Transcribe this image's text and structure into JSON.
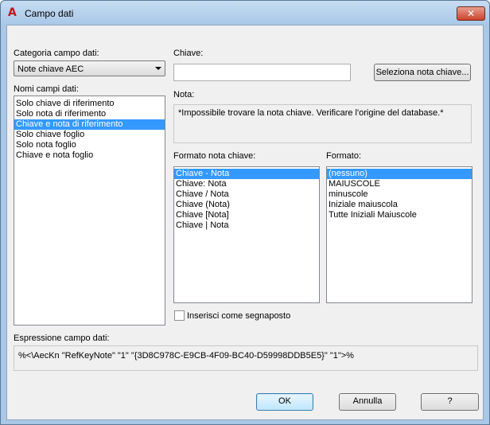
{
  "window": {
    "title": "Campo dati",
    "close_glyph": "✕",
    "app_icon": "A"
  },
  "category": {
    "label": "Categoria campo dati:",
    "selected": "Note chiave AEC"
  },
  "field_names": {
    "label": "Nomi campi dati:",
    "items": [
      {
        "label": "Solo chiave di riferimento",
        "selected": false
      },
      {
        "label": "Solo nota di riferimento",
        "selected": false
      },
      {
        "label": "Chiave e nota di riferimento",
        "selected": true
      },
      {
        "label": "Solo chiave foglio",
        "selected": false
      },
      {
        "label": "Solo nota foglio",
        "selected": false
      },
      {
        "label": "Chiave e nota foglio",
        "selected": false
      }
    ]
  },
  "key": {
    "label": "Chiave:",
    "value": "",
    "select_button": "Seleziona nota chiave..."
  },
  "note": {
    "label": "Nota:",
    "text": "*Impossibile trovare la nota chiave. Verificare l'origine del database.*"
  },
  "key_note_format": {
    "label": "Formato nota chiave:",
    "items": [
      {
        "label": "Chiave - Nota",
        "selected": true
      },
      {
        "label": "Chiave: Nota",
        "selected": false
      },
      {
        "label": "Chiave / Nota",
        "selected": false
      },
      {
        "label": "Chiave (Nota)",
        "selected": false
      },
      {
        "label": "Chiave [Nota]",
        "selected": false
      },
      {
        "label": "Chiave | Nota",
        "selected": false
      }
    ]
  },
  "format": {
    "label": "Formato:",
    "items": [
      {
        "label": "(nessuno)",
        "selected": true
      },
      {
        "label": "MAIUSCOLE",
        "selected": false
      },
      {
        "label": "minuscole",
        "selected": false
      },
      {
        "label": "Iniziale maiuscola",
        "selected": false
      },
      {
        "label": "Tutte Iniziali Maiuscole",
        "selected": false
      }
    ]
  },
  "placeholder_option": {
    "label": "Inserisci come segnaposto",
    "checked": false
  },
  "expression": {
    "label": "Espressione campo dati:",
    "text": "%<\\AecKn \"RefKeyNote\" \"1\" \"{3D8C978C-E9CB-4F09-BC40-D59998DDB5E5}\" \"1\">%"
  },
  "buttons": {
    "ok": "OK",
    "cancel": "Annulla",
    "help": "?"
  },
  "colors": {
    "selection": "#3399ff",
    "title_gradient_top": "#c6dcf2",
    "close_button": "#c9432b"
  }
}
